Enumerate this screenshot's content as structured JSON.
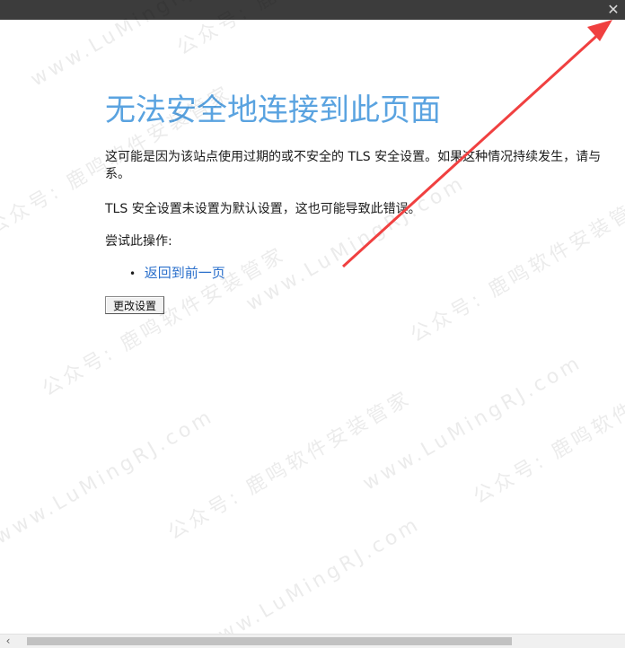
{
  "window": {
    "close_symbol": "✕"
  },
  "error_page": {
    "title": "无法安全地连接到此页面",
    "description_1": "这可能是因为该站点使用过期的或不安全的 TLS 安全设置。如果这种情况持续发生，请与",
    "description_1_cont": "系。",
    "description_2": "TLS 安全设置未设置为默认设置，这也可能导致此错误。",
    "try_label": "尝试此操作:",
    "actions": [
      {
        "label": "返回到前一页"
      }
    ],
    "change_settings_button": "更改设置"
  },
  "watermarks": {
    "text_site": "www.LuMingRJ.com",
    "text_account": "公众号: 鹿鸣软件安装管家",
    "color": "#000000"
  },
  "annotation": {
    "arrow_color": "#f04040"
  },
  "scrollbar": {
    "left_arrow_symbol": "‹"
  }
}
